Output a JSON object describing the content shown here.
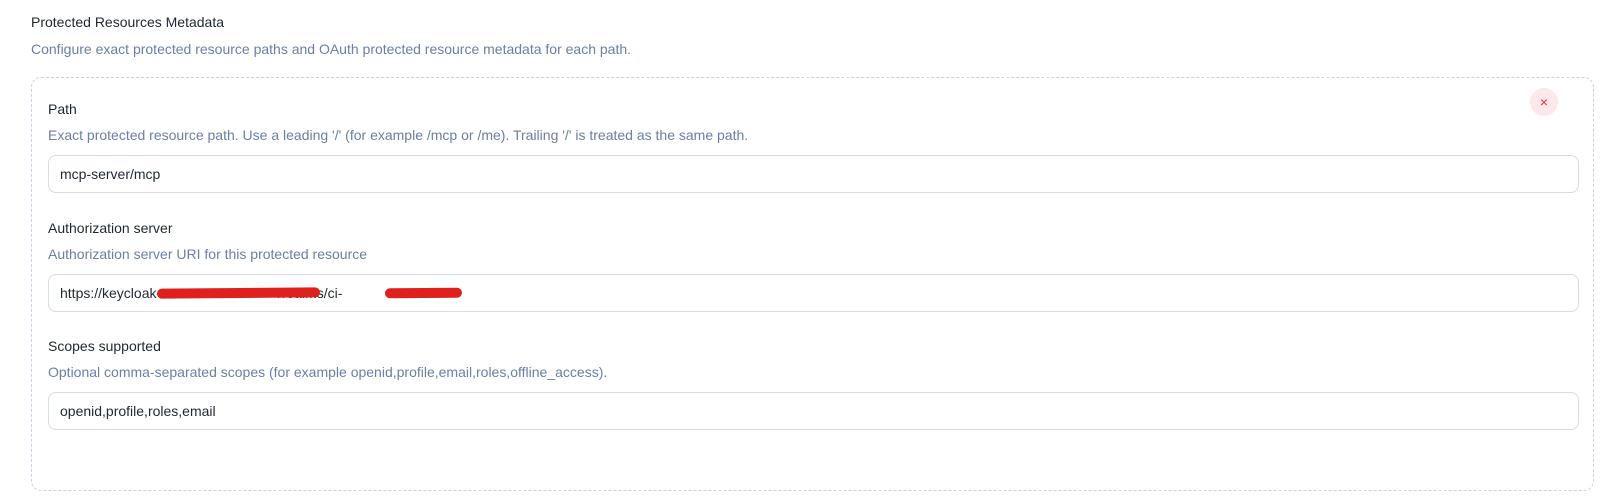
{
  "section": {
    "title": "Protected Resources Metadata",
    "description": "Configure exact protected resource paths and OAuth protected resource metadata for each path."
  },
  "resource": {
    "remove_label": "×",
    "path": {
      "label": "Path",
      "help": "Exact protected resource path. Use a leading '/' (for example /mcp or /me). Trailing '/' is treated as the same path.",
      "value": "mcp-server/mcp"
    },
    "authorization_server": {
      "label": "Authorization server",
      "help": "Authorization server URI for this protected resource",
      "value": "https://keycloak-                              /realms/ci-              "
    },
    "scopes": {
      "label": "Scopes supported",
      "help": "Optional comma-separated scopes (for example openid,profile,email,roles,offline_access).",
      "value": "openid,profile,roles,email"
    }
  },
  "colors": {
    "accent_text": "#6b7ea6",
    "remove_bg": "#fde7ea",
    "remove_fg": "#e53445",
    "redaction": "#e0201d"
  }
}
